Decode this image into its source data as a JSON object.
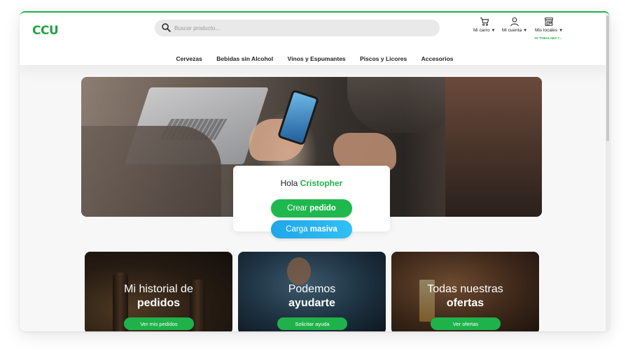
{
  "brand": {
    "logo_text": "CCU",
    "accent": "#1fb24a"
  },
  "search": {
    "placeholder": "Buscar producto..."
  },
  "header": {
    "cart_label": "Mi carro",
    "account_label": "Mi cuenta",
    "stores_label": "Mis locales",
    "store_selected": "AV TOBALABA 7..."
  },
  "nav": {
    "items": [
      {
        "label": "Cervezas"
      },
      {
        "label": "Bebidas sin Alcohol"
      },
      {
        "label": "Vinos y Espumantes"
      },
      {
        "label": "Piscos y Licores"
      },
      {
        "label": "Accesorios"
      }
    ]
  },
  "greeting": {
    "hello": "Hola",
    "name": "Cristopher",
    "primary_prefix": "Crear",
    "primary_bold": "pedido",
    "secondary_prefix": "Carga",
    "secondary_bold": "masiva"
  },
  "cards": [
    {
      "line1": "Mi historial de",
      "line2": "pedidos",
      "cta": "Ver mis pedidos"
    },
    {
      "line1": "Podemos",
      "line2": "ayudarte",
      "cta": "Solicitar ayuda"
    },
    {
      "line1": "Todas nuestras",
      "line2": "ofertas",
      "cta": "Ver ofertas"
    }
  ]
}
